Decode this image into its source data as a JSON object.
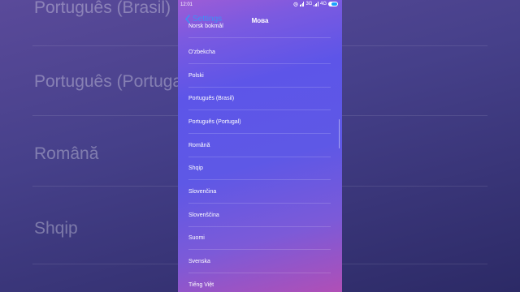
{
  "background": {
    "texts": [
      "Português (Brasil)",
      "Português (Portugal)",
      "Română",
      "Shqip"
    ]
  },
  "status_bar": {
    "time": "12:01",
    "network_3g": "3G",
    "network_4g": "4G"
  },
  "nav": {
    "back_label": "Settings",
    "title": "Мова"
  },
  "languages": [
    "Norsk bokmål",
    "O'zbekcha",
    "Polski",
    "Português (Brasil)",
    "Português (Portugal)",
    "Română",
    "Shqip",
    "Slovenčina",
    "Slovenščina",
    "Suomi",
    "Svenska",
    "Tiếng Việt"
  ],
  "colors": {
    "accent": "#3f8ff5",
    "battery": "#1aa3ff"
  }
}
